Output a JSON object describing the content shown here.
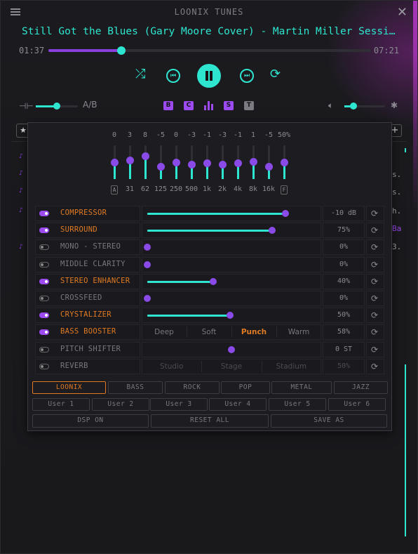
{
  "app": {
    "title": "LOONIX TUNES"
  },
  "player": {
    "track_title": "Still Got the Blues (Gary Moore Cover) - Martin Miller Session …",
    "elapsed": "01:37",
    "duration": "07:21",
    "progress": 0.226,
    "volume": 0.22,
    "balance": 0.5
  },
  "toolbar_badges": [
    "B",
    "C",
    "S",
    "T"
  ],
  "ab_label": "A/B",
  "playlist": {
    "right_snippets": [
      "s.",
      "s.",
      "h.",
      "Ba",
      "3."
    ]
  },
  "equalizer": {
    "values": [
      "0",
      "3",
      "8",
      "-5",
      "0",
      "-3",
      "-1",
      "-3",
      "-1",
      "1",
      "-5",
      "50%"
    ],
    "levels": [
      0.5,
      0.57,
      0.68,
      0.38,
      0.5,
      0.43,
      0.48,
      0.43,
      0.48,
      0.52,
      0.38,
      0.5
    ],
    "freqs": [
      "A",
      "31",
      "62",
      "125",
      "250",
      "500",
      "1k",
      "2k",
      "4k",
      "8k",
      "16k",
      "F"
    ]
  },
  "effects": [
    {
      "label": "COMPRESSOR",
      "on": true,
      "level": 0.82,
      "value": "-10 dB"
    },
    {
      "label": "SURROUND",
      "on": true,
      "level": 0.74,
      "value": "75%"
    },
    {
      "label": "MONO - STEREO",
      "on": false,
      "level": 0.0,
      "value": "0%"
    },
    {
      "label": "MIDDLE CLARITY",
      "on": false,
      "level": 0.0,
      "value": "0%"
    },
    {
      "label": "STEREO ENHANCER",
      "on": true,
      "level": 0.39,
      "value": "40%"
    },
    {
      "label": "CROSSFEED",
      "on": false,
      "level": 0.0,
      "value": "0%"
    },
    {
      "label": "CRYSTALIZER",
      "on": true,
      "level": 0.49,
      "value": "50%"
    },
    {
      "label": "BASS BOOSTER",
      "on": true,
      "options": [
        "Deep",
        "Soft",
        "Punch",
        "Warm"
      ],
      "selected": "Punch",
      "value": "58%"
    },
    {
      "label": "PITCH SHIFTER",
      "on": false,
      "level": 0.5,
      "value": "0 ST"
    },
    {
      "label": "REVERB",
      "on": false,
      "options": [
        "Studio",
        "Stage",
        "Stadium"
      ],
      "selected": "",
      "value": "50%"
    }
  ],
  "presets": [
    "LOONIX",
    "BASS",
    "ROCK",
    "POP",
    "METAL",
    "JAZZ"
  ],
  "selected_preset": "LOONIX",
  "user_presets": [
    "User 1",
    "User 2",
    "User 3",
    "User 4",
    "User 5",
    "User 6"
  ],
  "actions": [
    "DSP ON",
    "RESET ALL",
    "SAVE AS"
  ],
  "colors": {
    "accent": "#2ee6cf",
    "purple": "#9b4bf0",
    "orange": "#e07a22"
  }
}
